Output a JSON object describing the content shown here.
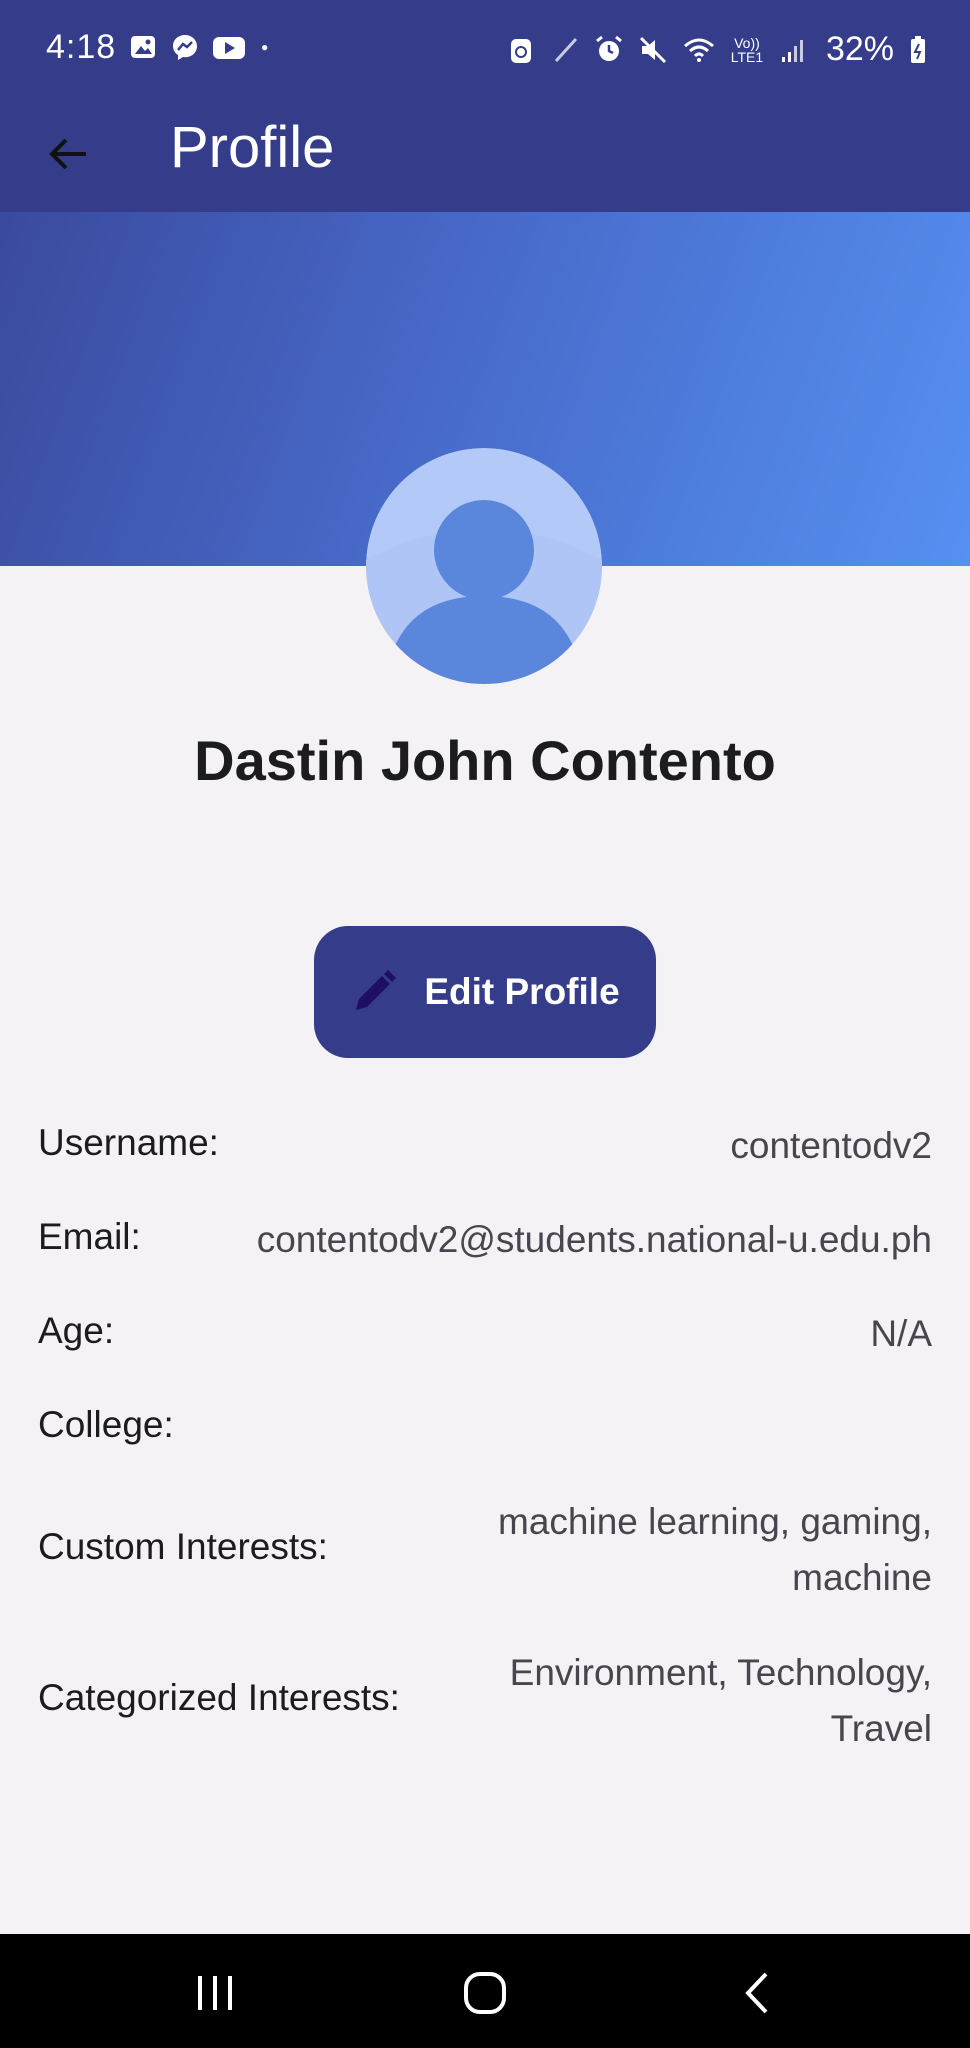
{
  "status_bar": {
    "time": "4:18",
    "battery": "32%",
    "left_icons": [
      "gallery-icon",
      "messenger-icon",
      "youtube-icon",
      "dot-icon"
    ],
    "right_icons": [
      "recycle-icon",
      "pen-icon",
      "alarm-icon",
      "mute-icon",
      "wifi-icon",
      "volte-icon",
      "signal-icon",
      "battery-icon"
    ],
    "volte_label": "Vo)) LTE1"
  },
  "app_bar": {
    "title": "Profile",
    "back_icon": "arrow-left-icon"
  },
  "profile": {
    "name": "Dastin John Contento",
    "edit_button_label": "Edit Profile"
  },
  "info": {
    "username_label": "Username:",
    "username_value": "contentodv2",
    "email_label": "Email:",
    "email_value": "contentodv2@students.national-u.edu.ph",
    "age_label": "Age:",
    "age_value": "N/A",
    "college_label": "College:",
    "college_value": "",
    "custom_interests_label": "Custom Interests:",
    "custom_interests_line1": "machine learning, gaming,",
    "custom_interests_line2": "machine",
    "categorized_interests_label": "Categorized Interests:",
    "categorized_interests_line1": "Environment, Technology,",
    "categorized_interests_line2": "Travel"
  },
  "colors": {
    "primary": "#353d8a",
    "banner_start": "#3a4a9e",
    "banner_end": "#5690f2",
    "avatar_bg": "#b3caf8",
    "avatar_figure": "#5a87dc",
    "background": "#f4f2f5"
  }
}
